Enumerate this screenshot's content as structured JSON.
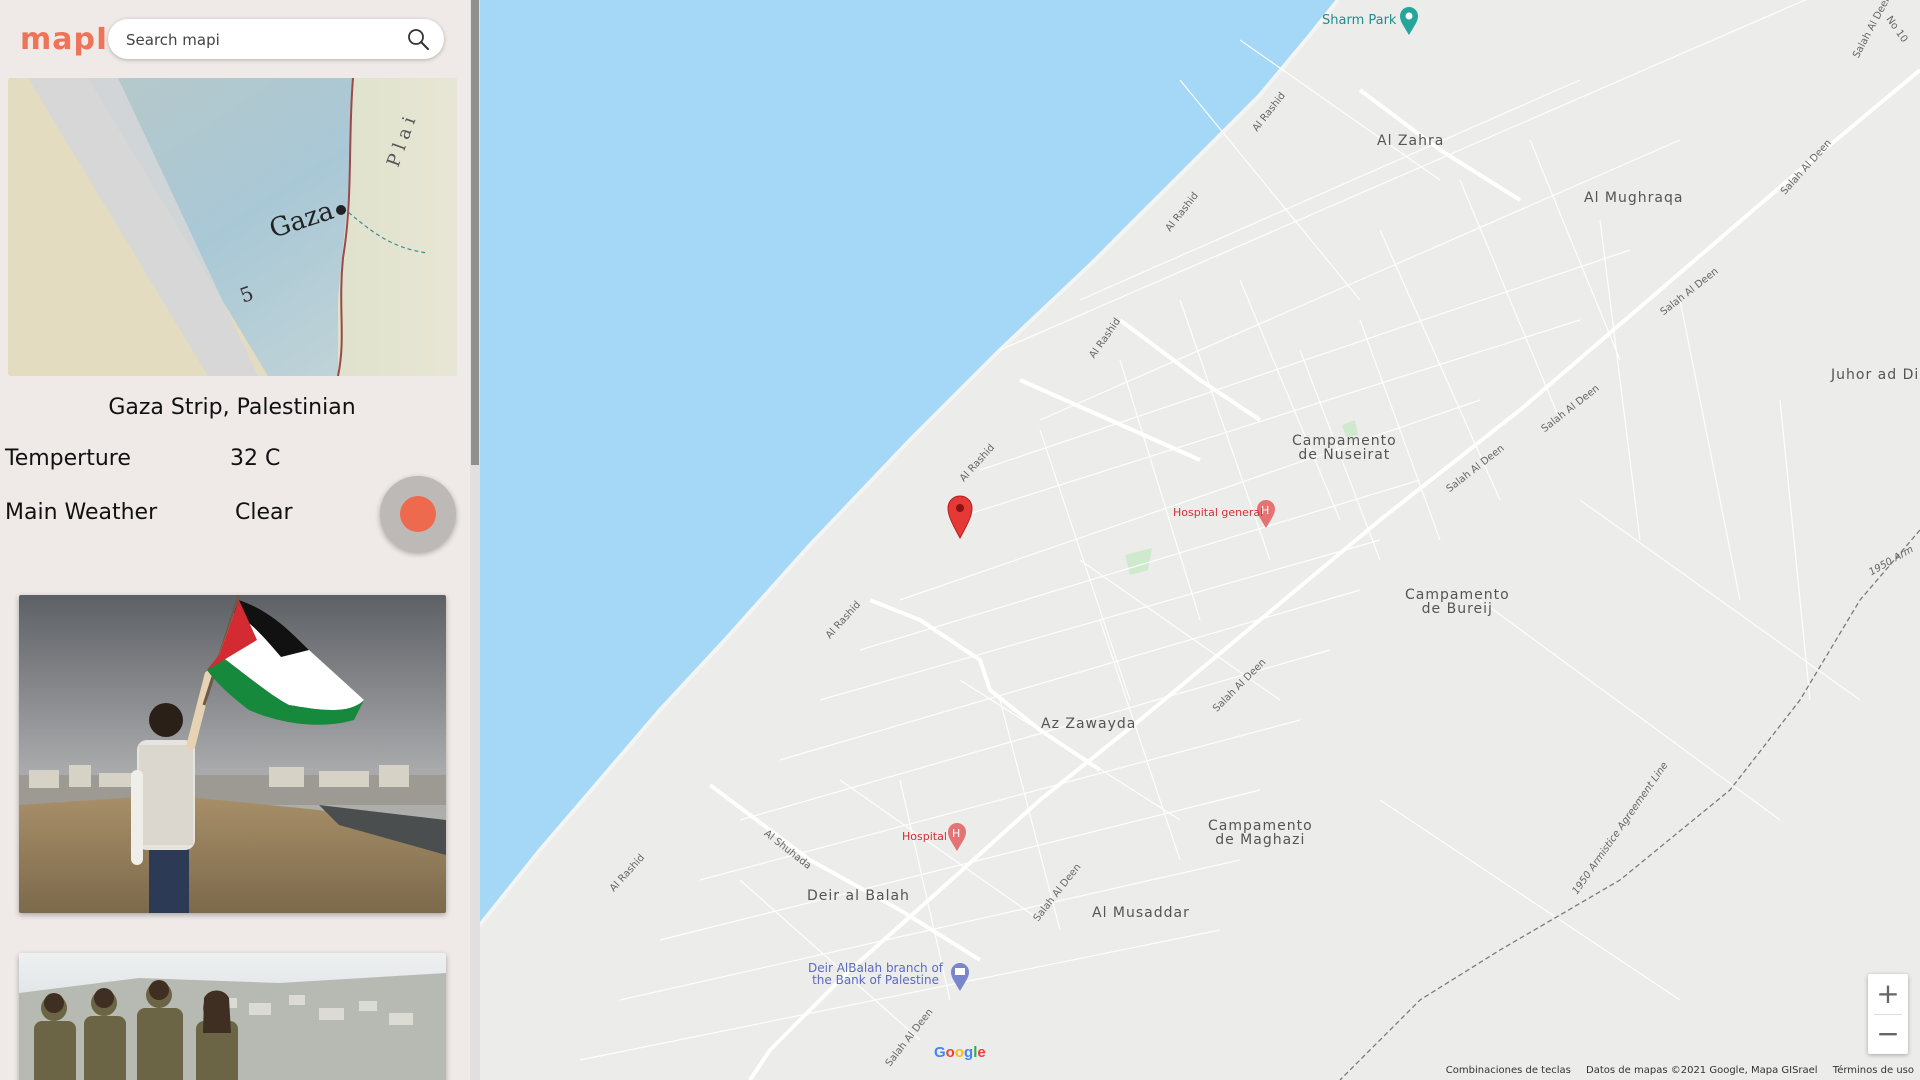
{
  "app": {
    "logo": "mapI"
  },
  "search": {
    "placeholder": "Search mapi"
  },
  "place": {
    "name": "Gaza Strip, Palestinian",
    "temperature_label": "Temperture",
    "temperature_value": "32 C",
    "weather_label": "Main Weather",
    "weather_value": "Clear"
  },
  "photo_map": {
    "city_text": "Gaza",
    "number_text": "5"
  },
  "map": {
    "places": {
      "sharm_park": "Sharm Park",
      "al_zahra": "Al Zahra",
      "al_mughraqa": "Al Mughraqa",
      "juhor": "Juhor ad Di",
      "nuseirat": "Campamento\nde Nuseirat",
      "bureij": "Campamento\nde Bureij",
      "az_zawayda": "Az Zawayda",
      "maghazi": "Campamento\nde Maghazi",
      "deir_al_balah": "Deir al Balah",
      "al_musaddar": "Al Musaddar",
      "hospital_general": "Hospital general",
      "hospital": "Hospital",
      "bank": "Deir AlBalah branch of\nthe Bank of Palestine"
    },
    "roads": {
      "al_rashid": "Al Rashid",
      "salah_al_deen": "Salah Al Deen",
      "al_shuhada": "Al Shuhada",
      "armistice": "1950 Armistice Agreement Line",
      "armistice2": "1950 Arm",
      "no10": "No 10"
    },
    "zoom_in": "+",
    "zoom_out": "−",
    "google": "Google",
    "attribution": {
      "shortcuts": "Combinaciones de teclas",
      "data": "Datos de mapas ©2021 Google, Mapa GISrael",
      "terms": "Términos de uso"
    }
  },
  "colors": {
    "accent": "#ee7457",
    "sea": "#a5d8f7",
    "land": "#ececeb",
    "marker": "#e53935"
  }
}
